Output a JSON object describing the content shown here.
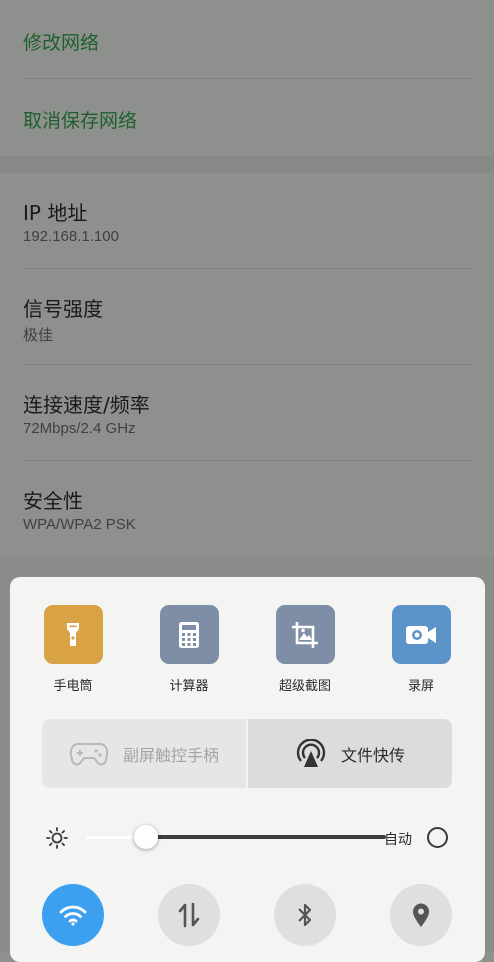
{
  "network_actions": {
    "modify": "修改网络",
    "forget": "取消保存网络"
  },
  "network_info": [
    {
      "title": "IP 地址",
      "value": "192.168.1.100"
    },
    {
      "title": "信号强度",
      "value": "极佳"
    },
    {
      "title": "连接速度/频率",
      "value": "72Mbps/2.4 GHz"
    },
    {
      "title": "安全性",
      "value": "WPA/WPA2 PSK"
    }
  ],
  "control_center": {
    "tiles": [
      {
        "label": "手电筒",
        "icon": "flashlight-icon",
        "color": "#d9a244"
      },
      {
        "label": "计算器",
        "icon": "calculator-icon",
        "color": "#7f8ea7"
      },
      {
        "label": "超级截图",
        "icon": "super-screenshot-icon",
        "color": "#7f8ea7"
      },
      {
        "label": "录屏",
        "icon": "screen-record-icon",
        "color": "#5c93c8"
      }
    ],
    "bar": {
      "gamepad_label": "副屏触控手柄",
      "file_share_label": "文件快传"
    },
    "brightness": {
      "level": 0.2,
      "auto_label": "自动"
    },
    "toggles": [
      {
        "icon": "wifi-icon",
        "on": true
      },
      {
        "icon": "mobile-data-icon",
        "on": false
      },
      {
        "icon": "bluetooth-icon",
        "on": false
      },
      {
        "icon": "location-icon",
        "on": false
      }
    ]
  }
}
